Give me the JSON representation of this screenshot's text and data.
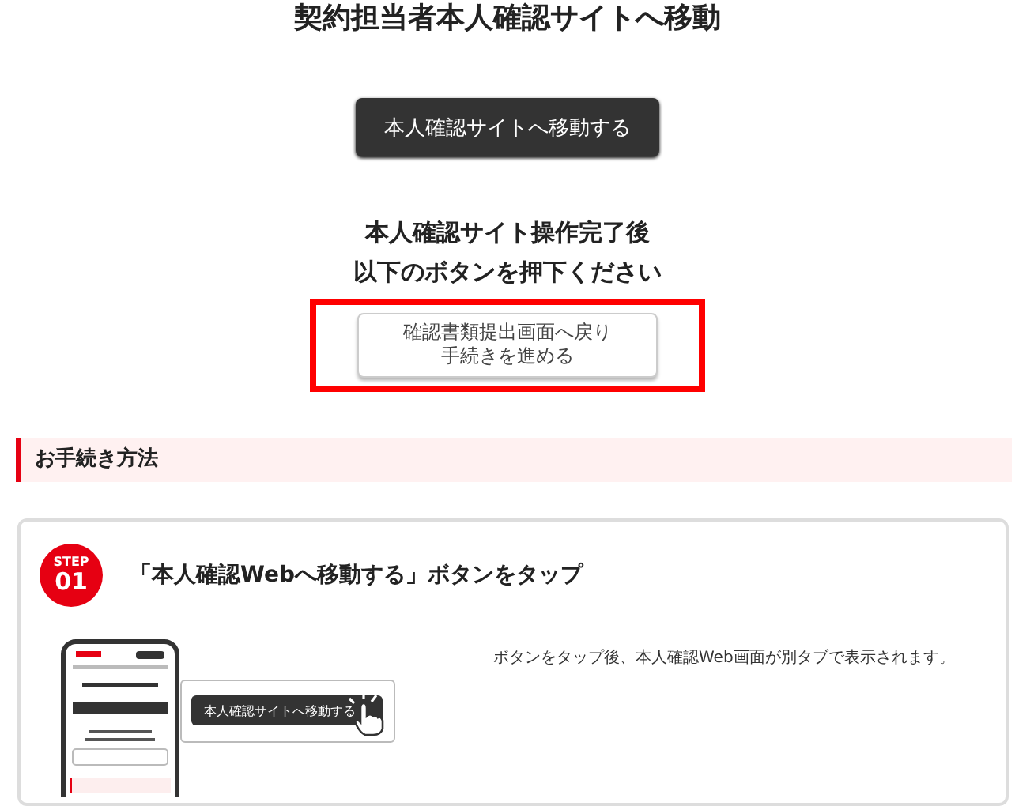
{
  "page_title": "契約担当者本人確認サイトへ移動",
  "primary_button": "本人確認サイトへ移動する",
  "instruction_lines": [
    "本人確認サイト操作完了後",
    "以下のボタンを押下ください"
  ],
  "return_button": {
    "lines": [
      "確認書類提出画面へ戻り",
      "手続きを進める"
    ],
    "highlighted": true
  },
  "section_heading": "お手続き方法",
  "steps": [
    {
      "label": "STEP",
      "number": "01",
      "title": "「本人確認Webへ移動する」ボタンをタップ",
      "callout_button": "本人確認サイトへ移動する",
      "description": "ボタンをタップ後、本人確認Web画面が別タブで表示されます。"
    }
  ]
}
